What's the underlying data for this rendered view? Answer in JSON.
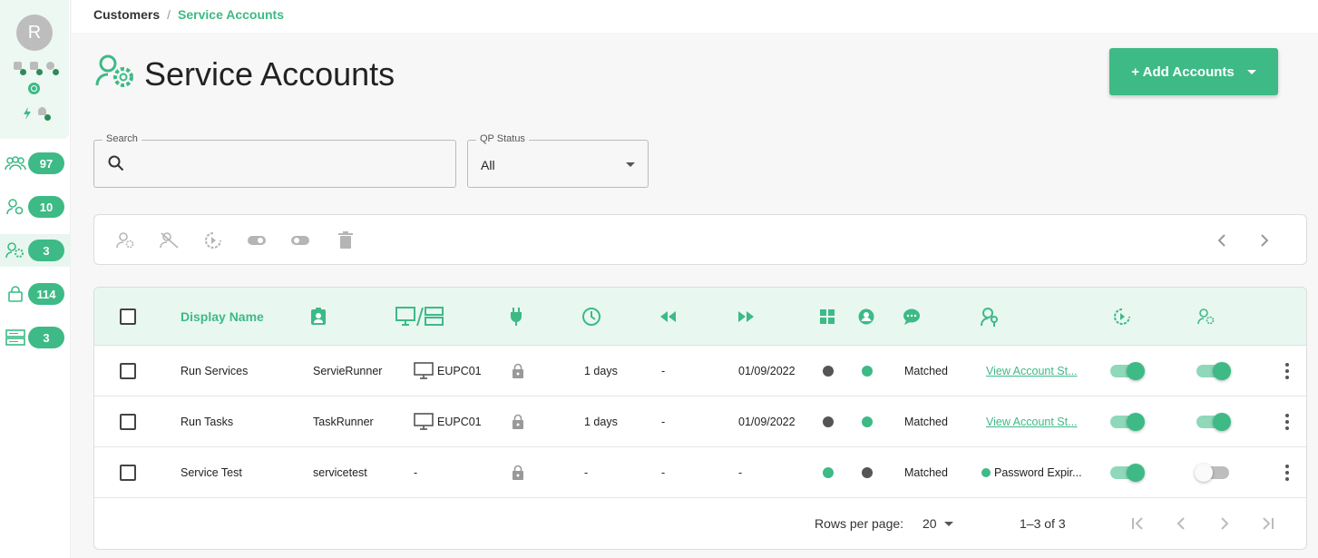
{
  "sidebar": {
    "avatar_letter": "R",
    "items": [
      {
        "icon": "users-group-icon",
        "count": "97"
      },
      {
        "icon": "user-settings-icon",
        "count": "10"
      },
      {
        "icon": "service-accounts-icon",
        "count": "3"
      },
      {
        "icon": "lock-icon",
        "count": "114"
      },
      {
        "icon": "server-icon",
        "count": "3"
      }
    ]
  },
  "breadcrumb": {
    "root": "Customers",
    "separator": "/",
    "current": "Service Accounts"
  },
  "page_title": "Service Accounts",
  "add_button_label": "+ Add Accounts",
  "filters": {
    "search_label": "Search",
    "search_placeholder": "",
    "qp_status_label": "QP Status",
    "qp_status_value": "All"
  },
  "table": {
    "headers": {
      "display_name": "Display Name"
    },
    "rows": [
      {
        "display_name": "Run Services",
        "username": "ServieRunner",
        "computer": "EUPC01",
        "interval": "1 days",
        "last": "-",
        "next": "01/09/2022",
        "windows": "dark",
        "ad": "green",
        "status": "Matched",
        "status_link": "View Account St...",
        "link_type": "link",
        "toggle1": "on",
        "toggle2": "on"
      },
      {
        "display_name": "Run Tasks",
        "username": "TaskRunner",
        "computer": "EUPC01",
        "interval": "1 days",
        "last": "-",
        "next": "01/09/2022",
        "windows": "dark",
        "ad": "green",
        "status": "Matched",
        "status_link": "View Account St...",
        "link_type": "link",
        "toggle1": "on",
        "toggle2": "on"
      },
      {
        "display_name": "Service Test",
        "username": "servicetest",
        "computer": "-",
        "interval": "-",
        "last": "-",
        "next": "-",
        "windows": "green",
        "ad": "dark",
        "status": "Matched",
        "status_link": "Password Expir...",
        "link_type": "dot",
        "toggle1": "on",
        "toggle2": "off"
      }
    ]
  },
  "footer": {
    "rows_per_page_label": "Rows per page:",
    "rows_per_page_value": "20",
    "range": "1–3 of 3"
  },
  "colors": {
    "accent": "#3dba86",
    "header_bg": "#e9f7f1"
  }
}
